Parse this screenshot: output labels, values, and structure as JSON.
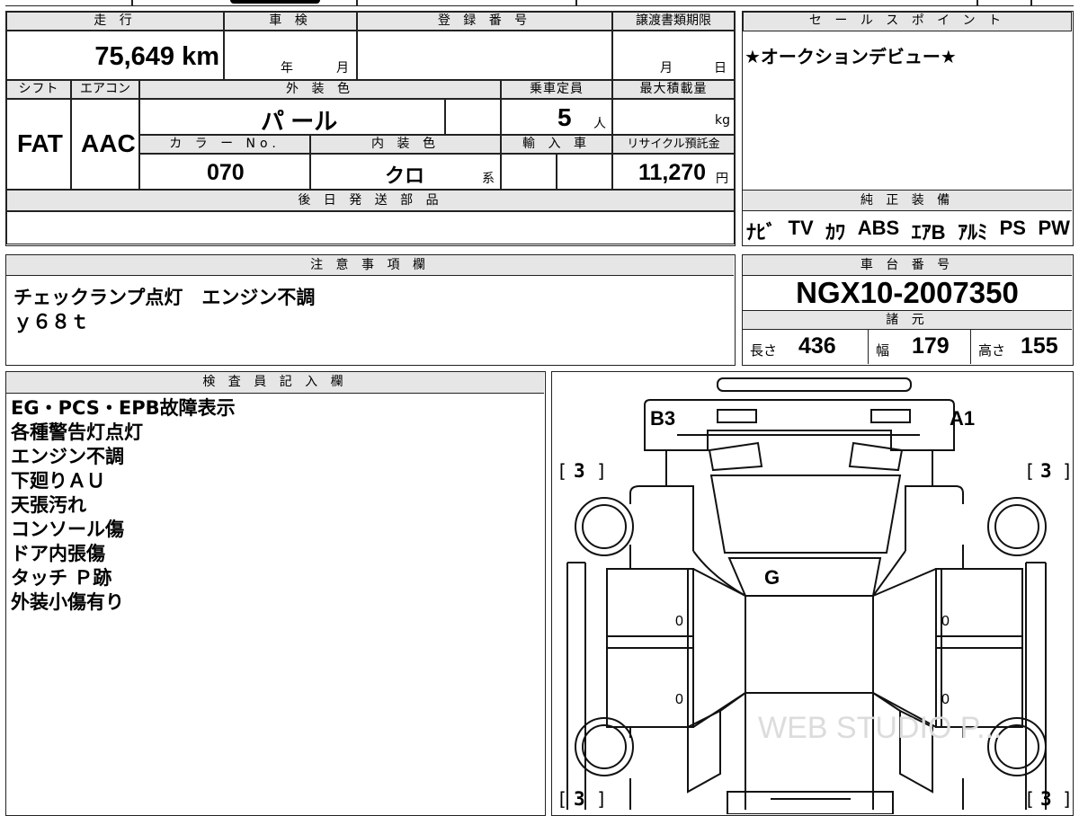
{
  "vehicle": {
    "mileage_header": "走 行",
    "mileage": "75,649 km",
    "inspection_header": "車 検",
    "inspection_year_unit": "年",
    "inspection_month_unit": "月",
    "registration_header": "登 録 番 号",
    "transfer_deadline_header": "譲渡書類期限",
    "transfer_month_unit": "月",
    "transfer_day_unit": "日",
    "shift_header": "シフト",
    "shift": "FAT",
    "aircon_header": "エアコン",
    "aircon": "AAC",
    "exterior_color_header": "外 装 色",
    "exterior_color": "パ ール",
    "capacity_header": "乗車定員",
    "capacity": "5",
    "capacity_unit": "人",
    "max_load_header": "最大積載量",
    "max_load_unit": "kg",
    "color_no_header": "カ ラ ー No.",
    "color_no": "070",
    "interior_color_header": "内 装 色",
    "interior_color": "クロ",
    "interior_color_suffix": "系",
    "import_header": "輸 入 車",
    "recycle_fee_header": "リサイクル預託金",
    "recycle_fee": "11,270",
    "recycle_fee_unit": "円",
    "later_parts_header": "後 日 発 送 部 品"
  },
  "sales_point": {
    "header": "セ ー ル ス ポ イ ン ト",
    "text": "★オークションデビュー★"
  },
  "equipment": {
    "header": "純 正 装 備",
    "items": [
      "ﾅﾋﾞ",
      "TV",
      "ｶﾜ",
      "ABS",
      "ｴｱB",
      "ｱﾙﾐ",
      "PS",
      "PW"
    ]
  },
  "cautions": {
    "header": "注 意 事 項 欄",
    "lines": [
      "チェックランプ点灯　エンジン不調",
      "ｙ６８ｔ"
    ]
  },
  "chassis": {
    "header": "車 台 番 号",
    "number": "NGX10-2007350",
    "specs_header": "諸 元",
    "length_label": "長さ",
    "length": "436",
    "width_label": "幅",
    "width": "179",
    "height_label": "高さ",
    "height": "155"
  },
  "inspector": {
    "header": "検 査 員 記 入 欄",
    "lines": [
      "EG・PCS・EPB故障表示",
      "各種警告灯点灯",
      "エンジン不調",
      "下廻りＡＵ",
      "天張汚れ",
      "コンソール傷",
      "ドア内張傷",
      "タッチ Ｐ跡",
      "外装小傷有り"
    ]
  },
  "diagram": {
    "label_b3": "B3",
    "label_a1": "A1",
    "label_g": "G",
    "tire_score": "3",
    "zero_mark": "0",
    "watermark": "WEB STUDIO P..."
  }
}
